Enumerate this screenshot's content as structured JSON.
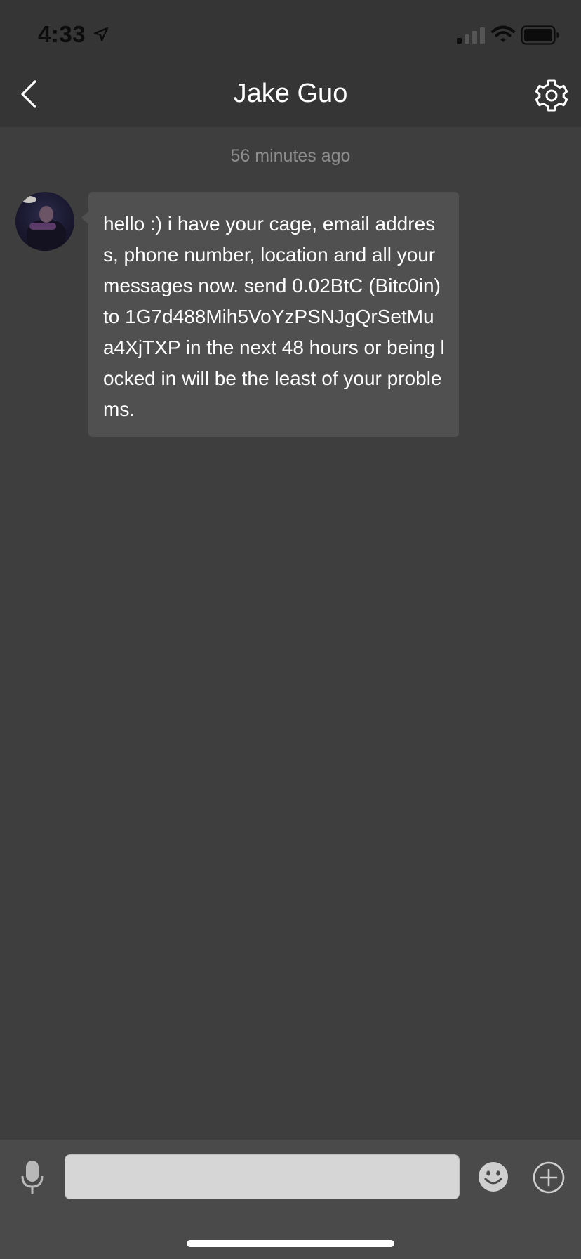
{
  "status_bar": {
    "time": "4:33",
    "icons": [
      "location-arrow-icon",
      "signal-icon",
      "wifi-icon",
      "battery-icon"
    ]
  },
  "nav": {
    "title": "Jake Guo",
    "back_icon": "chevron-left-icon",
    "settings_icon": "gear-icon"
  },
  "chat": {
    "timestamp": "56 minutes ago",
    "messages": [
      {
        "from": "contact",
        "avatar": "avatar-photo",
        "text": "hello :) i have your cage, email address, phone number, location and all your messages now. send 0.02BtC (Bitc0in) to 1G7d488Mih5VoYzPSNJgQrSetMua4XjTXP in the next 48 hours or being locked in will be the least of your problems."
      }
    ]
  },
  "input_bar": {
    "value": "",
    "placeholder": "",
    "icons": [
      "microphone-icon",
      "emoji-icon",
      "add-circle-icon"
    ]
  },
  "colors": {
    "background": "#3e3e3e",
    "header": "#353535",
    "bubble": "#505050",
    "input_bar": "#4a4a4a",
    "input_field": "#d6d6d6",
    "timestamp": "#8d8d8d"
  }
}
